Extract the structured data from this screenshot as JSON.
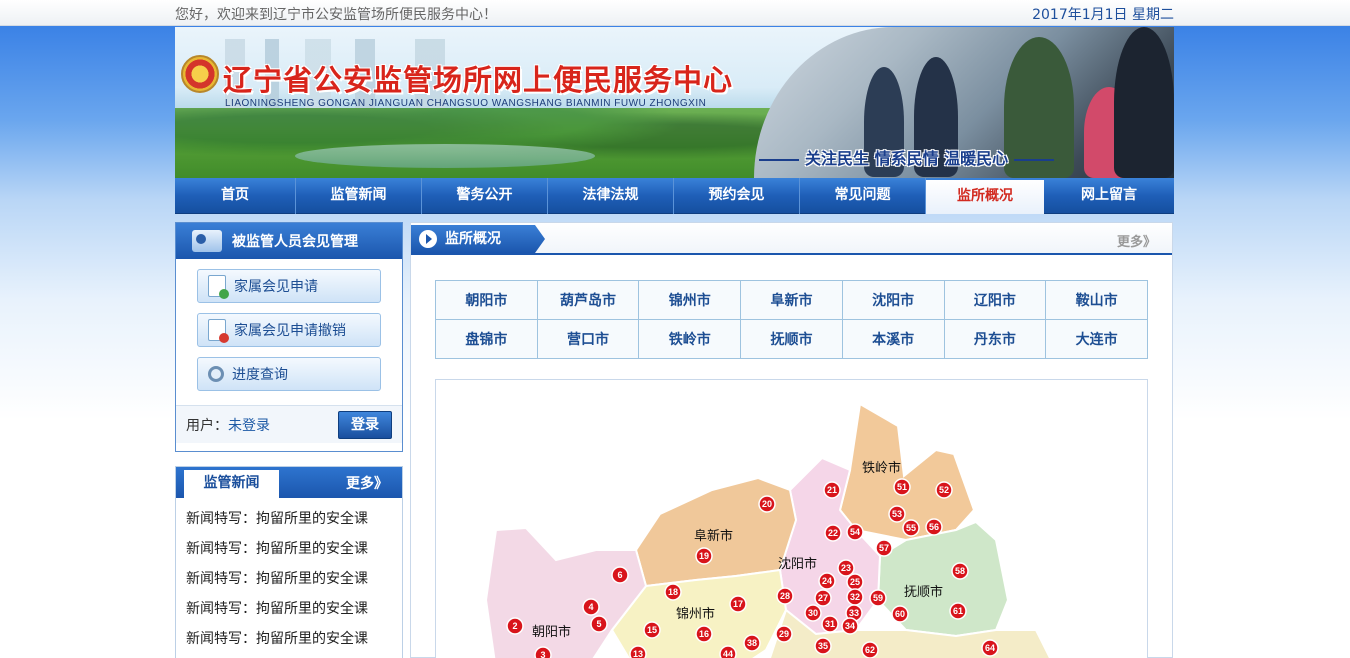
{
  "topbar": {
    "welcome": "您好，欢迎来到辽宁市公安监管场所便民服务中心！",
    "date": "2017年1月1日 星期二"
  },
  "banner": {
    "title": "辽宁省公安监管场所网上便民服务中心",
    "pinyin": "LIAONINGSHENG GONGAN JIANGUAN CHANGSUO WANGSHANG BIANMIN FUWU ZHONGXIN",
    "slogan": "关注民生  情系民情  温暖民心"
  },
  "nav": {
    "items": [
      "首页",
      "监管新闻",
      "警务公开",
      "法律法规",
      "预约会见",
      "常见问题",
      "监所概况",
      "网上留言"
    ],
    "active": "监所概况"
  },
  "visit_panel": {
    "title": "被监管人员会见管理",
    "buttons": [
      "家属会见申请",
      "家属会见申请撤销",
      "进度查询"
    ],
    "user_label": "用户：",
    "user_value": "未登录",
    "login_label": "登录"
  },
  "news_panel": {
    "tab": "监管新闻",
    "more": "更多》",
    "items": [
      "新闻特写：拘留所里的安全课",
      "新闻特写：拘留所里的安全课",
      "新闻特写：拘留所里的安全课",
      "新闻特写：拘留所里的安全课",
      "新闻特写：拘留所里的安全课"
    ]
  },
  "main": {
    "tab": "监所概况",
    "more": "更多》",
    "cities_row1": [
      "朝阳市",
      "葫芦岛市",
      "锦州市",
      "阜新市",
      "沈阳市",
      "辽阳市",
      "鞍山市"
    ],
    "cities_row2": [
      "盘锦市",
      "营口市",
      "铁岭市",
      "抚顺市",
      "本溪市",
      "丹东市",
      "大连市"
    ]
  },
  "map": {
    "colors": {
      "tieling": "#f2c99a",
      "fuxin": "#f0c89a",
      "shenyang": "#f5d6e8",
      "fushun": "#cfe7c9",
      "jinzhou": "#f7f2c4",
      "chaoyang": "#f3d9e6",
      "marker": "#d8141b"
    },
    "labels": [
      "铁岭市",
      "阜新市",
      "沈阳市",
      "抚顺市",
      "锦州市",
      "朝阳市"
    ],
    "markers": [
      "2",
      "3",
      "4",
      "5",
      "6",
      "13",
      "15",
      "16",
      "17",
      "18",
      "19",
      "20",
      "21",
      "22",
      "23",
      "24",
      "25",
      "27",
      "28",
      "29",
      "30",
      "31",
      "32",
      "33",
      "34",
      "35",
      "38",
      "44",
      "51",
      "52",
      "53",
      "54",
      "55",
      "56",
      "57",
      "58",
      "59",
      "60",
      "61",
      "62",
      "64"
    ]
  }
}
